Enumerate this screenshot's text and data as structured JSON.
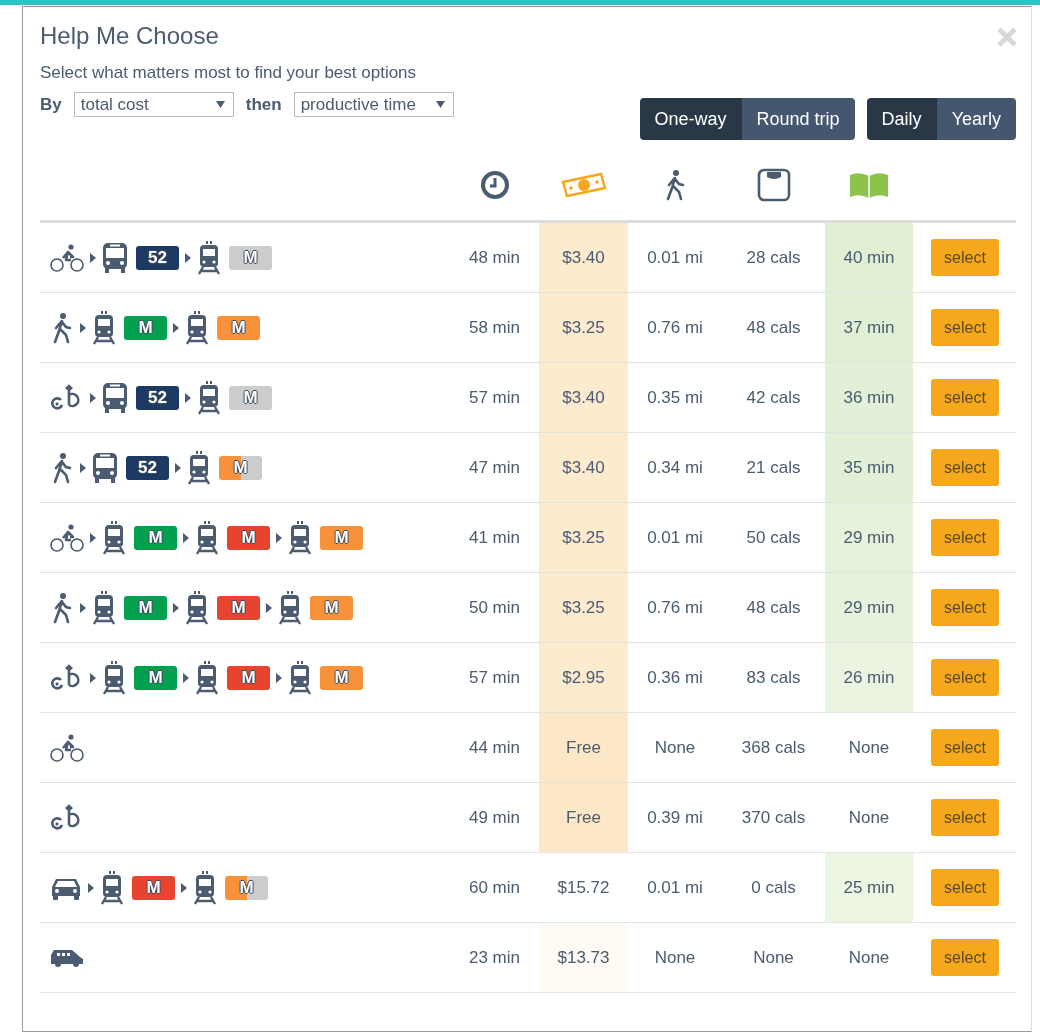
{
  "dialog": {
    "title": "Help Me Choose",
    "subtitle": "Select what matters most to find your best options"
  },
  "sort": {
    "by_label": "By",
    "by_value": "total cost",
    "then_label": "then",
    "then_value": "productive time"
  },
  "trip_toggle": [
    {
      "label": "One-way",
      "selected": true
    },
    {
      "label": "Round trip",
      "selected": false
    }
  ],
  "period_toggle": [
    {
      "label": "Daily",
      "selected": true
    },
    {
      "label": "Yearly",
      "selected": false
    }
  ],
  "rows": [
    {
      "legs": [
        {
          "kind": "bike"
        },
        {
          "kind": "bus",
          "badge": {
            "text": "52",
            "segments": [
              {
                "color": "#1d3a63"
              }
            ]
          }
        },
        {
          "kind": "train",
          "badge": {
            "text": "M",
            "segments": [
              {
                "color": "#cccccc"
              }
            ]
          }
        }
      ],
      "time": "48 min",
      "cost": {
        "text": "$3.40",
        "color": "#fdebd0"
      },
      "walk": "0.01 mi",
      "cals": "28 cals",
      "productive": {
        "text": "40 min",
        "color": "#e1efd5"
      },
      "action": "select"
    },
    {
      "legs": [
        {
          "kind": "walk"
        },
        {
          "kind": "train",
          "badge": {
            "text": "M",
            "segments": [
              {
                "color": "#00a04f"
              }
            ]
          }
        },
        {
          "kind": "train",
          "badge": {
            "text": "M",
            "segments": [
              {
                "color": "#f7923a"
              }
            ]
          }
        }
      ],
      "time": "58 min",
      "cost": {
        "text": "$3.25",
        "color": "#fdebd0"
      },
      "walk": "0.76 mi",
      "cals": "48 cals",
      "productive": {
        "text": "37 min",
        "color": "#e1efd5"
      },
      "action": "select"
    },
    {
      "legs": [
        {
          "kind": "bikeshare"
        },
        {
          "kind": "bus",
          "badge": {
            "text": "52",
            "segments": [
              {
                "color": "#1d3a63"
              }
            ]
          }
        },
        {
          "kind": "train",
          "badge": {
            "text": "M",
            "segments": [
              {
                "color": "#cccccc"
              }
            ]
          }
        }
      ],
      "time": "57 min",
      "cost": {
        "text": "$3.40",
        "color": "#fdebd0"
      },
      "walk": "0.35 mi",
      "cals": "42 cals",
      "productive": {
        "text": "36 min",
        "color": "#e2f0d7"
      },
      "action": "select"
    },
    {
      "legs": [
        {
          "kind": "walk"
        },
        {
          "kind": "bus",
          "badge": {
            "text": "52",
            "segments": [
              {
                "color": "#1d3a63"
              }
            ]
          }
        },
        {
          "kind": "train",
          "badge": {
            "text": "M",
            "segments": [
              {
                "color": "#f7923a"
              },
              {
                "color": "#cccccc"
              }
            ]
          }
        }
      ],
      "time": "47 min",
      "cost": {
        "text": "$3.40",
        "color": "#fdebd0"
      },
      "walk": "0.34 mi",
      "cals": "21 cals",
      "productive": {
        "text": "35 min",
        "color": "#e3f0d8"
      },
      "action": "select"
    },
    {
      "legs": [
        {
          "kind": "bike"
        },
        {
          "kind": "train",
          "badge": {
            "text": "M",
            "segments": [
              {
                "color": "#00a04f"
              }
            ]
          }
        },
        {
          "kind": "train",
          "badge": {
            "text": "M",
            "segments": [
              {
                "color": "#e8432f"
              }
            ]
          }
        },
        {
          "kind": "train",
          "badge": {
            "text": "M",
            "segments": [
              {
                "color": "#f7923a"
              }
            ]
          }
        }
      ],
      "time": "41 min",
      "cost": {
        "text": "$3.25",
        "color": "#fdebd0"
      },
      "walk": "0.01 mi",
      "cals": "50 cals",
      "productive": {
        "text": "29 min",
        "color": "#e6f2dc"
      },
      "action": "select"
    },
    {
      "legs": [
        {
          "kind": "walk"
        },
        {
          "kind": "train",
          "badge": {
            "text": "M",
            "segments": [
              {
                "color": "#00a04f"
              }
            ]
          }
        },
        {
          "kind": "train",
          "badge": {
            "text": "M",
            "segments": [
              {
                "color": "#e8432f"
              }
            ]
          }
        },
        {
          "kind": "train",
          "badge": {
            "text": "M",
            "segments": [
              {
                "color": "#f7923a"
              }
            ]
          }
        }
      ],
      "time": "50 min",
      "cost": {
        "text": "$3.25",
        "color": "#fdebd0"
      },
      "walk": "0.76 mi",
      "cals": "48 cals",
      "productive": {
        "text": "29 min",
        "color": "#e6f2dc"
      },
      "action": "select"
    },
    {
      "legs": [
        {
          "kind": "bikeshare"
        },
        {
          "kind": "train",
          "badge": {
            "text": "M",
            "segments": [
              {
                "color": "#00a04f"
              }
            ]
          }
        },
        {
          "kind": "train",
          "badge": {
            "text": "M",
            "segments": [
              {
                "color": "#e8432f"
              }
            ]
          }
        },
        {
          "kind": "train",
          "badge": {
            "text": "M",
            "segments": [
              {
                "color": "#f7923a"
              }
            ]
          }
        }
      ],
      "time": "57 min",
      "cost": {
        "text": "$2.95",
        "color": "#fdebd0"
      },
      "walk": "0.36 mi",
      "cals": "83 cals",
      "productive": {
        "text": "26 min",
        "color": "#eaf4e1"
      },
      "action": "select"
    },
    {
      "legs": [
        {
          "kind": "bike"
        }
      ],
      "time": "44 min",
      "cost": {
        "text": "Free",
        "color": "#fce8c6"
      },
      "walk": "None",
      "cals": "368 cals",
      "productive": {
        "text": "None",
        "color": "#ffffff"
      },
      "action": "select"
    },
    {
      "legs": [
        {
          "kind": "bikeshare"
        }
      ],
      "time": "49 min",
      "cost": {
        "text": "Free",
        "color": "#fce8c6"
      },
      "walk": "0.39 mi",
      "cals": "370 cals",
      "productive": {
        "text": "None",
        "color": "#ffffff"
      },
      "action": "select"
    },
    {
      "legs": [
        {
          "kind": "car"
        },
        {
          "kind": "train",
          "badge": {
            "text": "M",
            "segments": [
              {
                "color": "#e8432f"
              }
            ]
          }
        },
        {
          "kind": "train",
          "badge": {
            "text": "M",
            "segments": [
              {
                "color": "#f7923a"
              },
              {
                "color": "#cccccc"
              }
            ]
          }
        }
      ],
      "time": "60 min",
      "cost": {
        "text": "$15.72",
        "color": "#ffffff"
      },
      "walk": "0.01 mi",
      "cals": "0 cals",
      "productive": {
        "text": "25 min",
        "color": "#edf5e3"
      },
      "action": "select"
    },
    {
      "legs": [
        {
          "kind": "van"
        }
      ],
      "time": "23 min",
      "cost": {
        "text": "$13.73",
        "color": "#fffaf3"
      },
      "walk": "None",
      "cals": "None",
      "productive": {
        "text": "None",
        "color": "#ffffff"
      },
      "action": "select"
    }
  ]
}
